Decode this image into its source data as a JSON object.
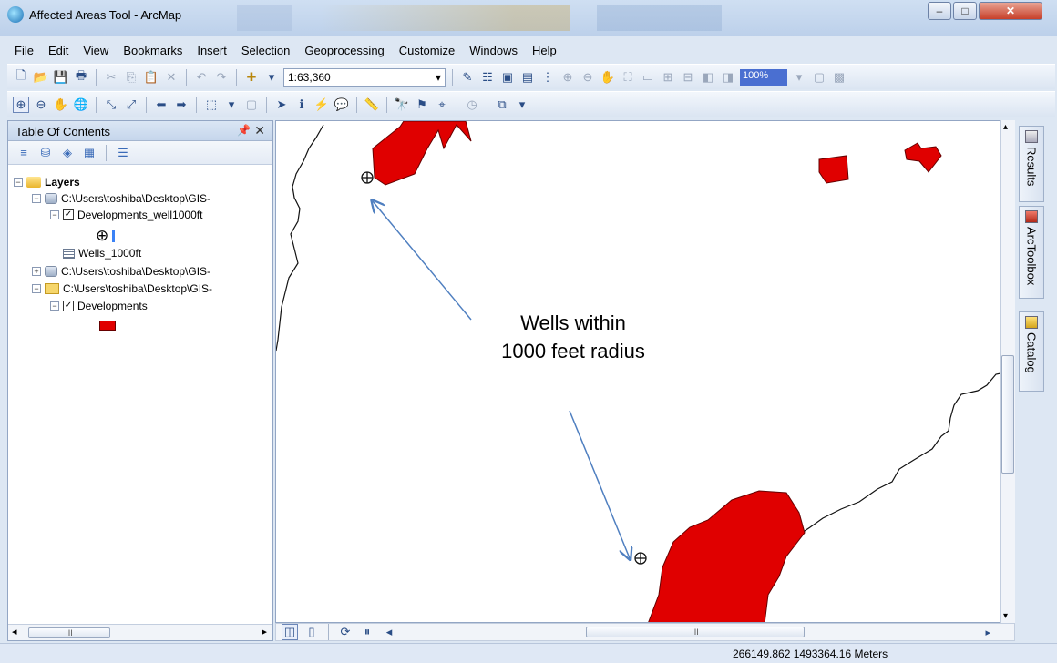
{
  "window": {
    "title": "Affected Areas Tool - ArcMap"
  },
  "menu": [
    "File",
    "Edit",
    "View",
    "Bookmarks",
    "Insert",
    "Selection",
    "Geoprocessing",
    "Customize",
    "Windows",
    "Help"
  ],
  "toolbar": {
    "scale": "1:63,360",
    "zoom_percent": "100%"
  },
  "toc": {
    "title": "Table Of Contents",
    "root": "Layers",
    "items": [
      {
        "label": "C:\\Users\\toshiba\\Desktop\\GIS-"
      },
      {
        "label": "Developments_well1000ft"
      },
      {
        "label": "Wells_1000ft"
      },
      {
        "label": "C:\\Users\\toshiba\\Desktop\\GIS-"
      },
      {
        "label": "C:\\Users\\toshiba\\Desktop\\GIS-"
      },
      {
        "label": "Developments"
      }
    ]
  },
  "annotation": {
    "line1": "Wells within",
    "line2": "1000 feet radius"
  },
  "dock": {
    "results": "Results",
    "toolbox": "ArcToolbox",
    "catalog": "Catalog"
  },
  "status": {
    "coordinates": "266149.862  1493364.16 Meters"
  },
  "scroll_glyph": "III",
  "colors": {
    "polygon_fill": "#e00000",
    "arrow": "#4f7fc0"
  }
}
